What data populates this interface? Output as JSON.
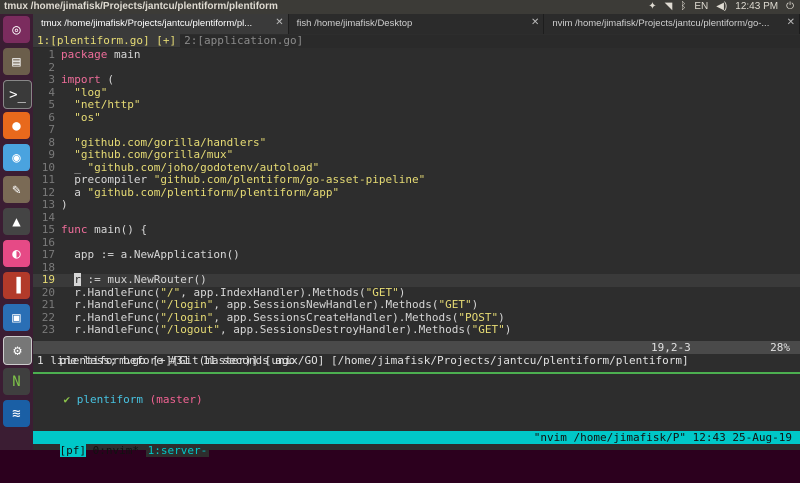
{
  "panel": {
    "title": "tmux /home/jimafisk/Projects/jantcu/plentiform/plentiform",
    "keyboard": "EN",
    "time": "12:43 PM"
  },
  "window_tabs": [
    {
      "label": "tmux /home/jimafisk/Projects/jantcu/plentiform/pl...",
      "close": "✕"
    },
    {
      "label": "fish /home/jimafisk/Desktop",
      "close": "✕"
    },
    {
      "label": "nvim /home/jimafisk/Projects/jantcu/plentiform/go-...",
      "close": "✕"
    }
  ],
  "vim_tabs": {
    "tab1": "1:[plentiform.go] [+]",
    "tab2": "2:[application.go]"
  },
  "code_lines": [
    {
      "n": "1",
      "parts": [
        [
          "kw",
          "package"
        ],
        [
          "fn",
          " main"
        ]
      ]
    },
    {
      "n": "2",
      "parts": []
    },
    {
      "n": "3",
      "parts": [
        [
          "kw",
          "import"
        ],
        [
          "fn",
          " ("
        ]
      ]
    },
    {
      "n": "4",
      "parts": [
        [
          "fn",
          "  "
        ],
        [
          "str",
          "\"log\""
        ]
      ]
    },
    {
      "n": "5",
      "parts": [
        [
          "fn",
          "  "
        ],
        [
          "str",
          "\"net/http\""
        ]
      ]
    },
    {
      "n": "6",
      "parts": [
        [
          "fn",
          "  "
        ],
        [
          "str",
          "\"os\""
        ]
      ]
    },
    {
      "n": "7",
      "parts": []
    },
    {
      "n": "8",
      "parts": [
        [
          "fn",
          "  "
        ],
        [
          "str",
          "\"github.com/gorilla/handlers\""
        ]
      ]
    },
    {
      "n": "9",
      "parts": [
        [
          "fn",
          "  "
        ],
        [
          "str",
          "\"github.com/gorilla/mux\""
        ]
      ]
    },
    {
      "n": "10",
      "parts": [
        [
          "fn",
          "  _ "
        ],
        [
          "str",
          "\"github.com/joho/godotenv/autoload\""
        ]
      ]
    },
    {
      "n": "11",
      "parts": [
        [
          "fn",
          "  precompiler "
        ],
        [
          "str",
          "\"github.com/plentiform/go-asset-pipeline\""
        ]
      ]
    },
    {
      "n": "12",
      "parts": [
        [
          "fn",
          "  a "
        ],
        [
          "str",
          "\"github.com/plentiform/plentiform/app\""
        ]
      ]
    },
    {
      "n": "13",
      "parts": [
        [
          "fn",
          ")"
        ]
      ]
    },
    {
      "n": "14",
      "parts": []
    },
    {
      "n": "15",
      "parts": [
        [
          "kw",
          "func"
        ],
        [
          "fn",
          " main() {"
        ]
      ]
    },
    {
      "n": "16",
      "parts": []
    },
    {
      "n": "17",
      "parts": [
        [
          "fn",
          "  app := a.NewApplication()"
        ]
      ]
    },
    {
      "n": "18",
      "parts": []
    },
    {
      "n": "19",
      "parts": [
        [
          "fn",
          "  "
        ],
        [
          "cursor",
          "r"
        ],
        [
          "fn",
          " := mux.NewRouter()"
        ]
      ],
      "current": true
    },
    {
      "n": "20",
      "parts": [
        [
          "fn",
          "  r.HandleFunc("
        ],
        [
          "str",
          "\"/\""
        ],
        [
          "fn",
          ", app.IndexHandler).Methods("
        ],
        [
          "str",
          "\"GET\""
        ],
        [
          "fn",
          ")"
        ]
      ]
    },
    {
      "n": "21",
      "parts": [
        [
          "fn",
          "  r.HandleFunc("
        ],
        [
          "str",
          "\"/login\""
        ],
        [
          "fn",
          ", app.SessionsNewHandler).Methods("
        ],
        [
          "str",
          "\"GET\""
        ],
        [
          "fn",
          ")"
        ]
      ]
    },
    {
      "n": "22",
      "parts": [
        [
          "fn",
          "  r.HandleFunc("
        ],
        [
          "str",
          "\"/login\""
        ],
        [
          "fn",
          ", app.SessionsCreateHandler).Methods("
        ],
        [
          "str",
          "\"POST\""
        ],
        [
          "fn",
          ")"
        ]
      ]
    },
    {
      "n": "23",
      "parts": [
        [
          "fn",
          "  r.HandleFunc("
        ],
        [
          "str",
          "\"/logout\""
        ],
        [
          "fn",
          ", app.SessionsDestroyHandler).Methods("
        ],
        [
          "str",
          "\"GET\""
        ],
        [
          "fn",
          ")"
        ]
      ]
    }
  ],
  "status": {
    "left": "plentiform.go [+][Git(master)] [unix/GO] [/home/jimafisk/Projects/jantcu/plentiform/plentiform]",
    "position": "19,2-3",
    "percent": "28%"
  },
  "message": "1 line less; before #31  11 seconds ago",
  "prompt": {
    "check": "✔",
    "dir": "plentiform",
    "branch": "(master)"
  },
  "tmux": {
    "session": "[pf]",
    "window0": "0:nvim*",
    "window1": "1:server-",
    "right": "\"nvim /home/jimafisk/P\" 12:43 25-Aug-19"
  },
  "launcher_icons": [
    "ubuntu-logo-icon",
    "files-icon",
    "terminal-icon",
    "firefox-icon",
    "chromium-icon",
    "gimp-icon",
    "inkscape-icon",
    "screenshot-icon",
    "filezilla-icon",
    "virtualbox-icon",
    "settings-icon",
    "node-icon",
    "wireshark-icon"
  ]
}
